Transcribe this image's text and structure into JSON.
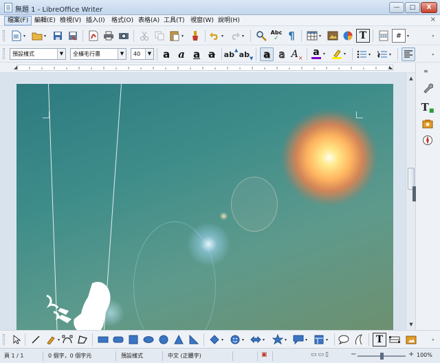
{
  "window": {
    "title": "無題 1 - LibreOffice Writer",
    "min_label": "—",
    "max_label": "□",
    "close_label": "X"
  },
  "menu": {
    "items": [
      "檔案(F)",
      "編輯(E)",
      "檢視(V)",
      "插入(I)",
      "格式(O)",
      "表格(A)",
      "工具(T)",
      "視窗(W)",
      "說明(H)"
    ],
    "close_doc": "×"
  },
  "toolbar_standard": {
    "icons": [
      "new-document",
      "open-folder",
      "save",
      "export-pdf",
      "print",
      "print-preview",
      "cut",
      "copy",
      "paste",
      "clone-formatting",
      "undo",
      "redo",
      "find-replace",
      "spelling",
      "formatting-marks",
      "insert-table",
      "insert-image",
      "insert-chart",
      "insert-textbox",
      "page-break",
      "insert-field"
    ],
    "spelling_label": "Abc",
    "pilcrow_label": "¶",
    "textbox_label": "T",
    "field_label": "#"
  },
  "toolbar_formatting": {
    "paragraph_style": "預設樣式",
    "font_name": "全橫毛行書",
    "font_size": "40",
    "bold_label": "a",
    "italic_label": "a",
    "underline_label": "a",
    "strike_label": "a",
    "superscript_label": "ab",
    "subscript_label": "ab",
    "shadow_label": "a",
    "outline_label": "a",
    "clear_label": "A",
    "font_color_label": "a",
    "font_color": "#7a00c9",
    "highlight_color": "#ffee00"
  },
  "sidebar": {
    "icons": [
      "properties",
      "styles",
      "gallery",
      "navigator"
    ],
    "styles_label": "T"
  },
  "drawing_toolbar": {
    "icons": [
      "select",
      "line",
      "freeform-line",
      "curve",
      "polygon",
      "rectangle",
      "rounded-rectangle",
      "square",
      "ellipse",
      "circle",
      "triangle",
      "right-triangle",
      "basic-shapes",
      "symbol-shapes",
      "block-arrows",
      "stars",
      "callouts",
      "flowchart",
      "callout-round",
      "insert-fontwork",
      "insert-textbox",
      "insert-frame",
      "insert-image-frame"
    ],
    "textbox_label": "T"
  },
  "status": {
    "page": "頁 1 / 1",
    "words": "0 個字，0 個字元",
    "page_style": "預設樣式",
    "language": "中文 (正體字)",
    "zoom": "100%",
    "zoom_fraction": 0.5
  }
}
